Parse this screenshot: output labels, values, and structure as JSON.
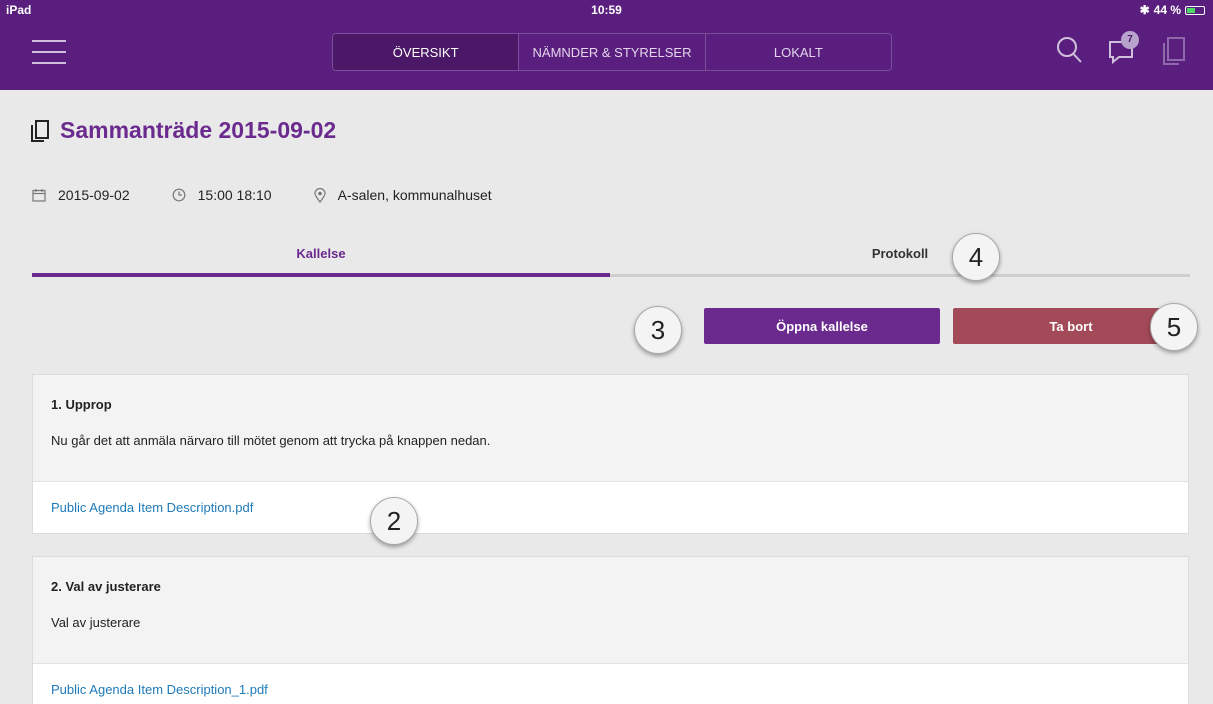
{
  "status_bar": {
    "device": "iPad",
    "time": "10:59",
    "battery": "44 %",
    "battery_level": 0.44
  },
  "nav": {
    "tabs": [
      {
        "label": "ÖVERSIKT",
        "active": true
      },
      {
        "label": "NÄMNDER & STYRELSER",
        "active": false
      },
      {
        "label": "LOKALT",
        "active": false
      }
    ],
    "notification_count": "7",
    "icons": [
      "menu-icon",
      "search-icon",
      "chat-icon",
      "documents-icon"
    ]
  },
  "meeting": {
    "title": "Sammanträde 2015-09-02",
    "date": "2015-09-02",
    "time": "15:00 18:10",
    "location": "A-salen, kommunalhuset"
  },
  "segments": {
    "kallelse": "Kallelse",
    "protokoll": "Protokoll"
  },
  "actions": {
    "open": "Öppna kallelse",
    "delete": "Ta bort"
  },
  "callouts": [
    "2",
    "3",
    "4",
    "5"
  ],
  "agenda": [
    {
      "title": "1. Upprop",
      "description": "Nu går det att anmäla närvaro till mötet genom att trycka på knappen nedan.",
      "file": "Public Agenda Item Description.pdf"
    },
    {
      "title": "2. Val av justerare",
      "description": "Val av justerare",
      "file": "Public Agenda Item Description_1.pdf"
    }
  ],
  "colors": {
    "header": "#5a1f7e",
    "accent": "#6b2a8e",
    "danger": "#a34a58",
    "link": "#1e7ab8"
  }
}
